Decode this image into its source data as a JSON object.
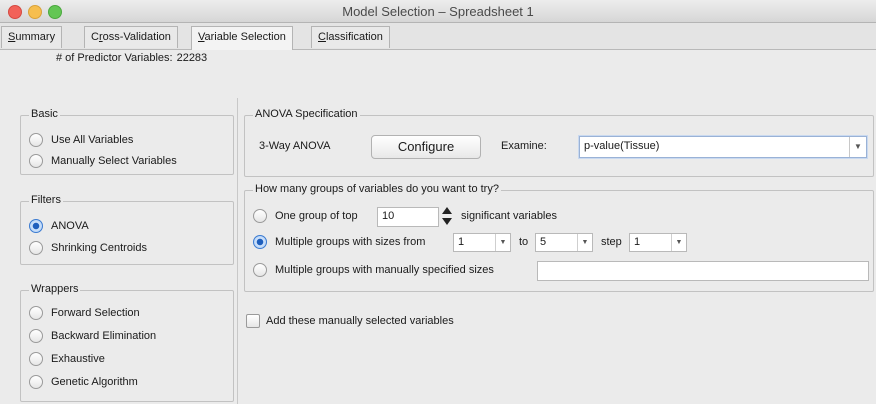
{
  "window": {
    "title": "Model Selection – Spreadsheet 1"
  },
  "tabs": [
    {
      "label": "Summary",
      "underline": "S",
      "rest": "ummary"
    },
    {
      "label": "Cross-Validation",
      "pre": "C",
      "underline": "r",
      "rest": "oss-Validation"
    },
    {
      "label": "Variable Selection",
      "underline": "V",
      "rest": "ariable Selection"
    },
    {
      "label": "Classification",
      "underline": "C",
      "rest": "lassification"
    }
  ],
  "predictor": {
    "label": "# of Predictor Variables:",
    "value": "22283"
  },
  "basic": {
    "legend": "Basic",
    "options": [
      "Use All Variables",
      "Manually Select Variables"
    ]
  },
  "filters": {
    "legend": "Filters",
    "options": [
      "ANOVA",
      "Shrinking Centroids"
    ]
  },
  "wrappers": {
    "legend": "Wrappers",
    "options": [
      "Forward Selection",
      "Backward Elimination",
      "Exhaustive",
      "Genetic Algorithm"
    ]
  },
  "anova": {
    "legend": "ANOVA Specification",
    "type_label": "3-Way ANOVA",
    "configure_label": "Configure",
    "examine_label": "Examine:",
    "examine_value": "p-value(Tissue)"
  },
  "groups": {
    "legend": "How many groups of variables do you want to try?",
    "opt1_pre": "One group of top",
    "opt1_value": "10",
    "opt1_post": "significant variables",
    "opt2_pre": "Multiple groups with sizes from",
    "from_value": "1",
    "to_label": "to",
    "to_value": "5",
    "step_label": "step",
    "step_value": "1",
    "opt3_label": "Multiple groups with manually specified sizes",
    "opt3_value": ""
  },
  "add_manual": {
    "label": "Add these manually selected variables"
  }
}
